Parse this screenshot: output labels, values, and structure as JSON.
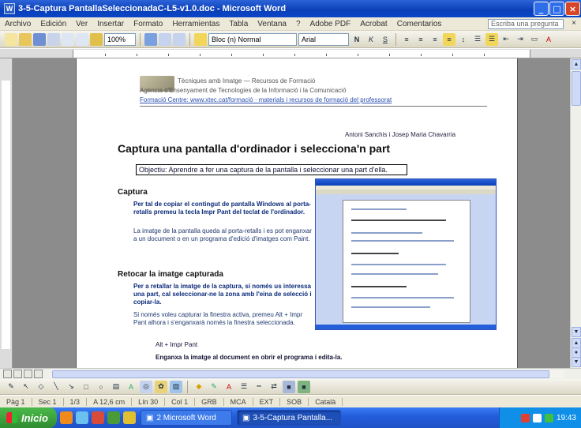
{
  "window": {
    "title": "3-5-Captura PantallaSeleccionadaC-L5-v1.0.doc - Microsoft Word",
    "buttons": {
      "minimize": "_",
      "maximize": "□",
      "close": "×"
    }
  },
  "menu": {
    "items": [
      "Archivo",
      "Edición",
      "Ver",
      "Insertar",
      "Formato",
      "Herramientas",
      "Tabla",
      "Ventana",
      "?",
      "Adobe PDF",
      "Acrobat",
      "Comentarios"
    ],
    "help_placeholder": "Escriba una pregunta",
    "close_glyph": "×"
  },
  "toolbar": {
    "zoom": "100%",
    "style": "Bloc (n) Normal",
    "font": "Arial"
  },
  "document": {
    "header_line1": "Tècniques amb Imatge — Recursos de Formació",
    "header_line2": "Agència d'Ensenyament de Tecnologies de la Informació i la Comunicació",
    "header_line3": "Formació Centre: www.xtec.cat/formació · materials i recursos de formació del professorat",
    "authors": "Antoni Sanchis i Josep Maria Chavarria",
    "title": "Captura una pantalla d'ordinador i selecciona'n part",
    "objective": "Objectiu: Aprendre a fer una captura de la pantalla i seleccionar una part d'ella.",
    "section1": "Captura",
    "para1": "Per tal de copiar el contingut de pantalla Windows al porta-retalls premeu la tecla Impr Pant del teclat de l'ordinador.",
    "para2": "La imatge de la pantalla queda al porta-retalls i es pot enganxar a un document o en un programa d'edició d'imatges com Paint.",
    "section2": "Retocar la imatge capturada",
    "para3": "Per a retallar la imatge de la captura, si només us interessa una part, cal seleccionar-ne la zona amb l'eina de selecció i copiar-la.",
    "para4": "Si només voleu capturar la finestra activa, premeu Alt + Impr Pant alhora i s'enganxarà només la finestra seleccionada.",
    "bullet1": "Alt + Impr Pant",
    "bullet2": "Enganxa la imatge al document en obrir el programa i edita-la."
  },
  "statusbar": {
    "page": "Pàg 1",
    "section": "Sec 1",
    "pages": "1/3",
    "position": "A 12,6 cm",
    "line": "Lín 30",
    "col": "Col 1",
    "rec": "GRB",
    "mark": "MCA",
    "ext": "EXT",
    "ovr": "SOB",
    "lang": "Català"
  },
  "taskbar": {
    "start": "Inicio",
    "tasks": [
      "2 Microsoft Word",
      "3-5-Captura Pantalla..."
    ],
    "time": "19:43"
  },
  "colors": {
    "titlebar": "#0a3fb8",
    "taskbar": "#245edb",
    "start": "#2f8d2f",
    "page_bg": "#8c8c8c"
  }
}
